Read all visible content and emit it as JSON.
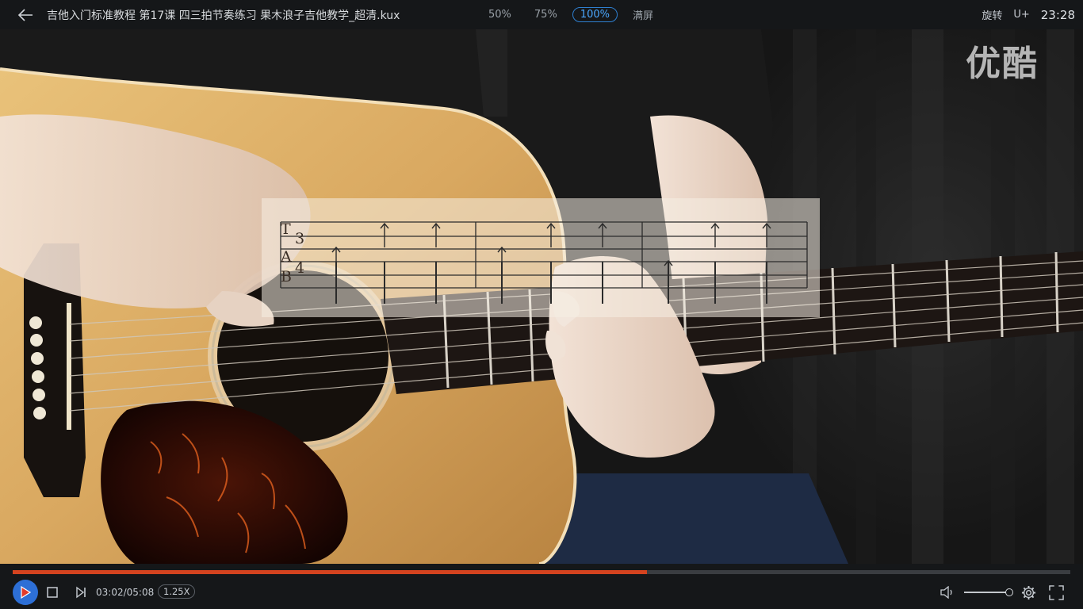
{
  "app": {
    "title": "吉他入门标准教程 第17课 四三拍节奏练习 果木浪子吉他教学_超清.kux",
    "zoom_options": [
      "50%",
      "75%",
      "100%",
      "满屏"
    ],
    "zoom_selected": "100%",
    "rotate_label": "旋转",
    "upload_label": "U+",
    "clock": "23:28"
  },
  "video": {
    "watermark": "优酷",
    "tab": {
      "letters": [
        "T",
        "A",
        "B"
      ],
      "time_signature_top": "3",
      "time_signature_bottom": "4"
    }
  },
  "player": {
    "progress": 0.6,
    "time_display": "03:02/05:08",
    "speed": "1.25X",
    "volume": 1.0
  },
  "colors": {
    "accent": "#2e7fd0",
    "progress": "#d4431f",
    "play_button": "#2d6fd6"
  },
  "icons": [
    "back-arrow-icon",
    "play-icon",
    "stop-icon",
    "next-icon",
    "volume-icon",
    "gear-icon",
    "fullscreen-icon"
  ]
}
